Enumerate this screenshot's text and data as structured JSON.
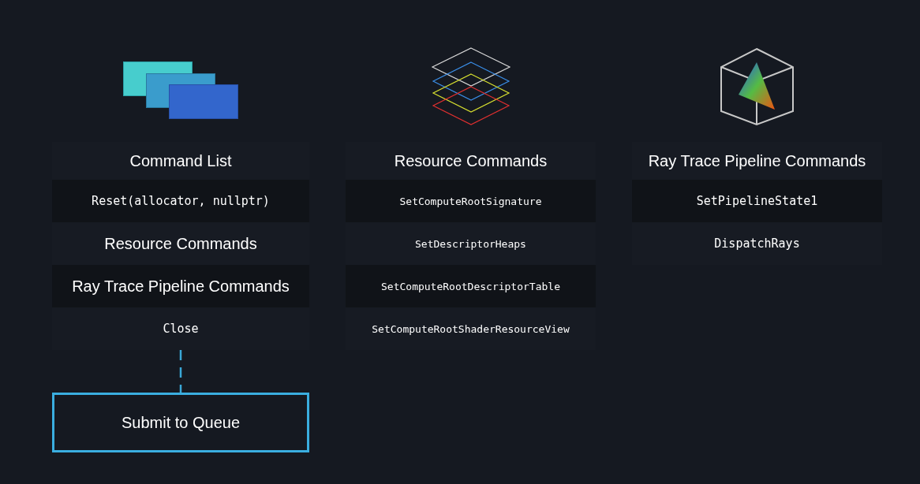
{
  "columns": [
    {
      "kind": "stacked-windows",
      "title": "Command List",
      "rows": [
        {
          "kind": "code",
          "text": "Reset(allocator, nullptr)"
        },
        {
          "kind": "label",
          "text": "Resource Commands"
        },
        {
          "kind": "label",
          "text": "Ray Trace Pipeline Commands"
        },
        {
          "kind": "code",
          "text": "Close"
        }
      ],
      "submit": "Submit to Queue"
    },
    {
      "kind": "layers",
      "title": "Resource Commands",
      "rows": [
        {
          "kind": "code",
          "text": "SetComputeRootSignature"
        },
        {
          "kind": "code",
          "text": "SetDescriptorHeaps"
        },
        {
          "kind": "code",
          "text": "SetComputeRootDescriptorTable"
        },
        {
          "kind": "code",
          "text": "SetComputeRootShaderResourceView"
        }
      ]
    },
    {
      "kind": "cube",
      "title": "Ray Trace Pipeline Commands",
      "rows": [
        {
          "kind": "code",
          "text": "SetPipelineState1"
        },
        {
          "kind": "code",
          "text": "DispatchRays"
        }
      ]
    }
  ]
}
